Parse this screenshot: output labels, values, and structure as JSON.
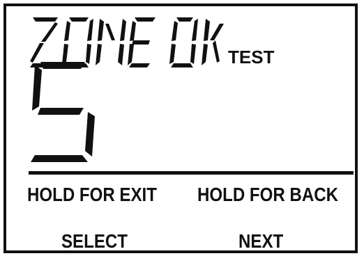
{
  "display": {
    "status_text": "ZONE OK",
    "mode_label": "TEST",
    "zone_number": "5"
  },
  "softkeys": {
    "hold_exit": "HOLD FOR EXIT",
    "hold_back": "HOLD FOR BACK",
    "select": "SELECT",
    "next": "NEXT"
  },
  "colors": {
    "segment": "#111111",
    "background": "#ffffff"
  }
}
